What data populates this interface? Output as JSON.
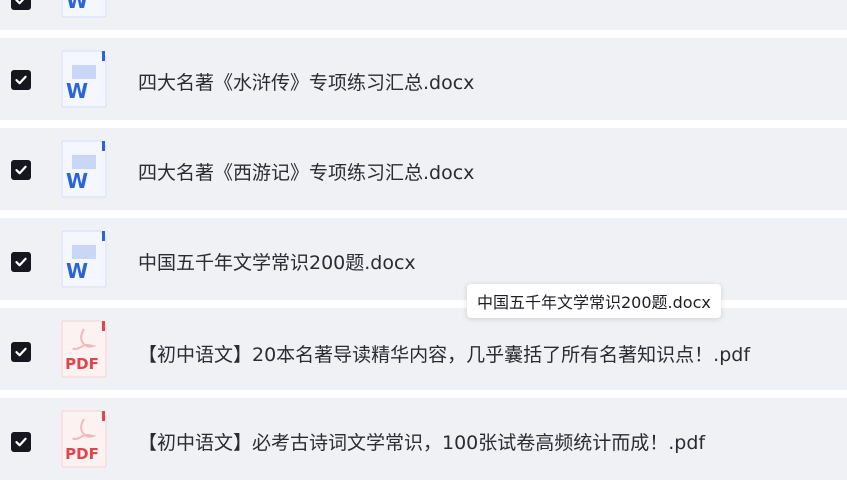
{
  "files": [
    {
      "name": "",
      "type": "word",
      "checked": true
    },
    {
      "name": "四大名著《水浒传》专项练习汇总.docx",
      "type": "word",
      "checked": true
    },
    {
      "name": "四大名著《西游记》专项练习汇总.docx",
      "type": "word",
      "checked": true
    },
    {
      "name": "中国五千年文学常识200题.docx",
      "type": "word",
      "checked": true
    },
    {
      "name": "【初中语文】20本名著导读精华内容，几乎囊括了所有名著知识点！.pdf",
      "type": "pdf",
      "checked": true
    },
    {
      "name": "【初中语文】必考古诗词文学常识，100张试卷高频统计而成！.pdf",
      "type": "pdf",
      "checked": true
    }
  ],
  "icons": {
    "word_letter": "W",
    "pdf_label": "PDF",
    "word_color": "#2b63d9",
    "pdf_color": "#e0454b"
  },
  "tooltip": {
    "text": "中国五千年文学常识200题.docx"
  }
}
